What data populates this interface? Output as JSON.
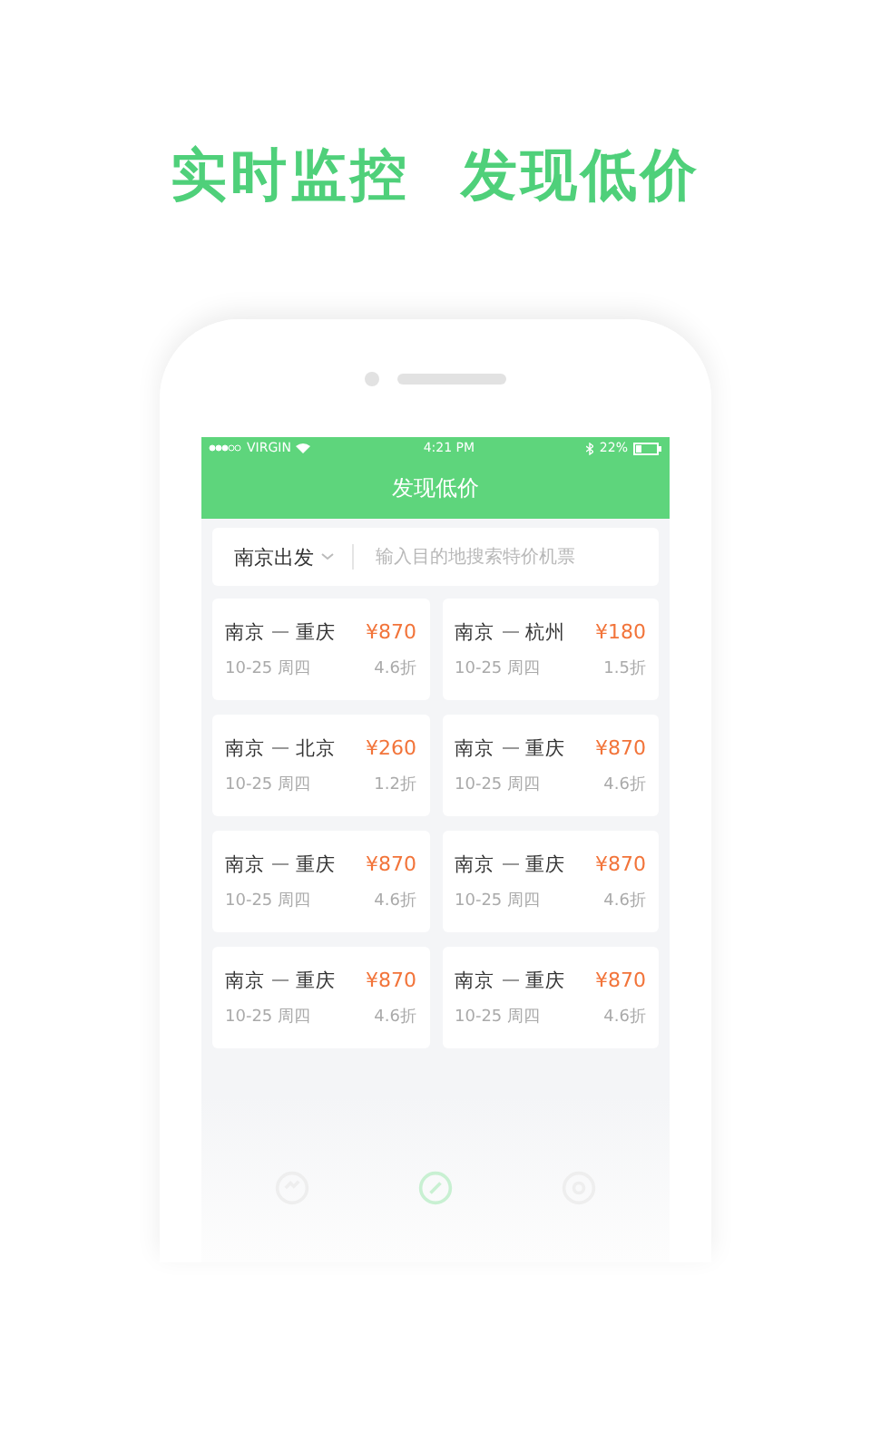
{
  "headline": [
    "实时监控",
    "发现低价"
  ],
  "status_bar": {
    "carrier": "VIRGIN",
    "time": "4:21 PM",
    "battery": "22%"
  },
  "nav": {
    "title": "发现低价"
  },
  "search": {
    "origin": "南京出发",
    "placeholder": "输入目的地搜索特价机票"
  },
  "deals": [
    {
      "from": "南京",
      "to": "重庆",
      "price": "¥870",
      "date": "10-25 周四",
      "discount": "4.6折"
    },
    {
      "from": "南京",
      "to": "杭州",
      "price": "¥180",
      "date": "10-25 周四",
      "discount": "1.5折"
    },
    {
      "from": "南京",
      "to": "北京",
      "price": "¥260",
      "date": "10-25 周四",
      "discount": "1.2折"
    },
    {
      "from": "南京",
      "to": "重庆",
      "price": "¥870",
      "date": "10-25 周四",
      "discount": "4.6折"
    },
    {
      "from": "南京",
      "to": "重庆",
      "price": "¥870",
      "date": "10-25 周四",
      "discount": "4.6折"
    },
    {
      "from": "南京",
      "to": "重庆",
      "price": "¥870",
      "date": "10-25 周四",
      "discount": "4.6折"
    },
    {
      "from": "南京",
      "to": "重庆",
      "price": "¥870",
      "date": "10-25 周四",
      "discount": "4.6折"
    },
    {
      "from": "南京",
      "to": "重庆",
      "price": "¥870",
      "date": "10-25 周四",
      "discount": "4.6折"
    }
  ],
  "tab_bar": [
    {
      "kind": "monitor",
      "selected": false
    },
    {
      "kind": "discover",
      "selected": true
    },
    {
      "kind": "profile",
      "selected": false
    }
  ]
}
